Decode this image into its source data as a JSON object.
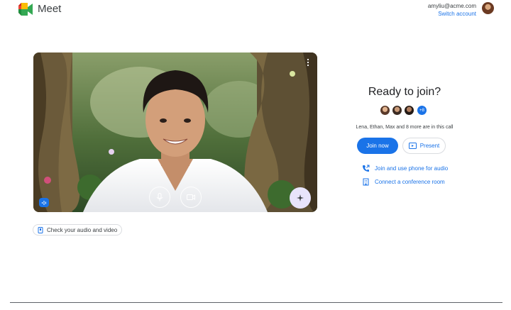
{
  "app": {
    "title": "Meet"
  },
  "account": {
    "email": "amyliu@acme.com",
    "switch_label": "Switch account"
  },
  "preview": {
    "check_audio_video_label": "Check your audio and video"
  },
  "join_panel": {
    "heading": "Ready to join?",
    "more_participants_badge": "+8",
    "participants_text": "Lena, Ethan, Max and 8 more are in this call",
    "join_now_label": "Join now",
    "present_label": "Present",
    "phone_audio_label": "Join and use phone for audio",
    "conference_room_label": "Connect a conference room"
  },
  "colors": {
    "accent": "#1a73e8",
    "effects_button": "#e8e4fb"
  }
}
